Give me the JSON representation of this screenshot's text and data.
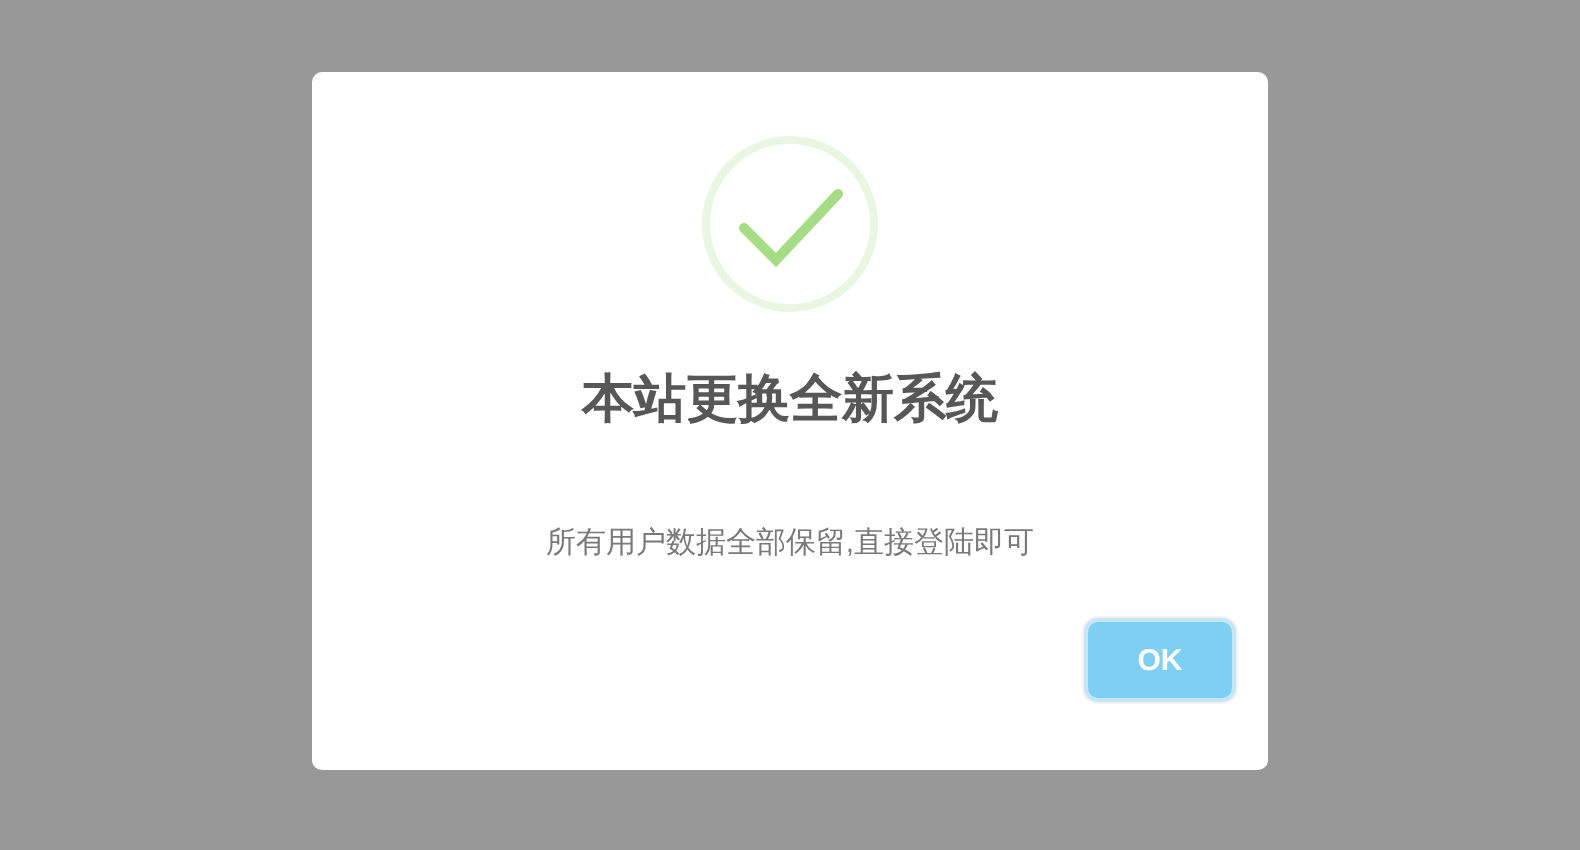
{
  "dialog": {
    "title": "本站更换全新系统",
    "message": "所有用户数据全部保留,直接登陆即可",
    "confirm_button": "OK"
  }
}
